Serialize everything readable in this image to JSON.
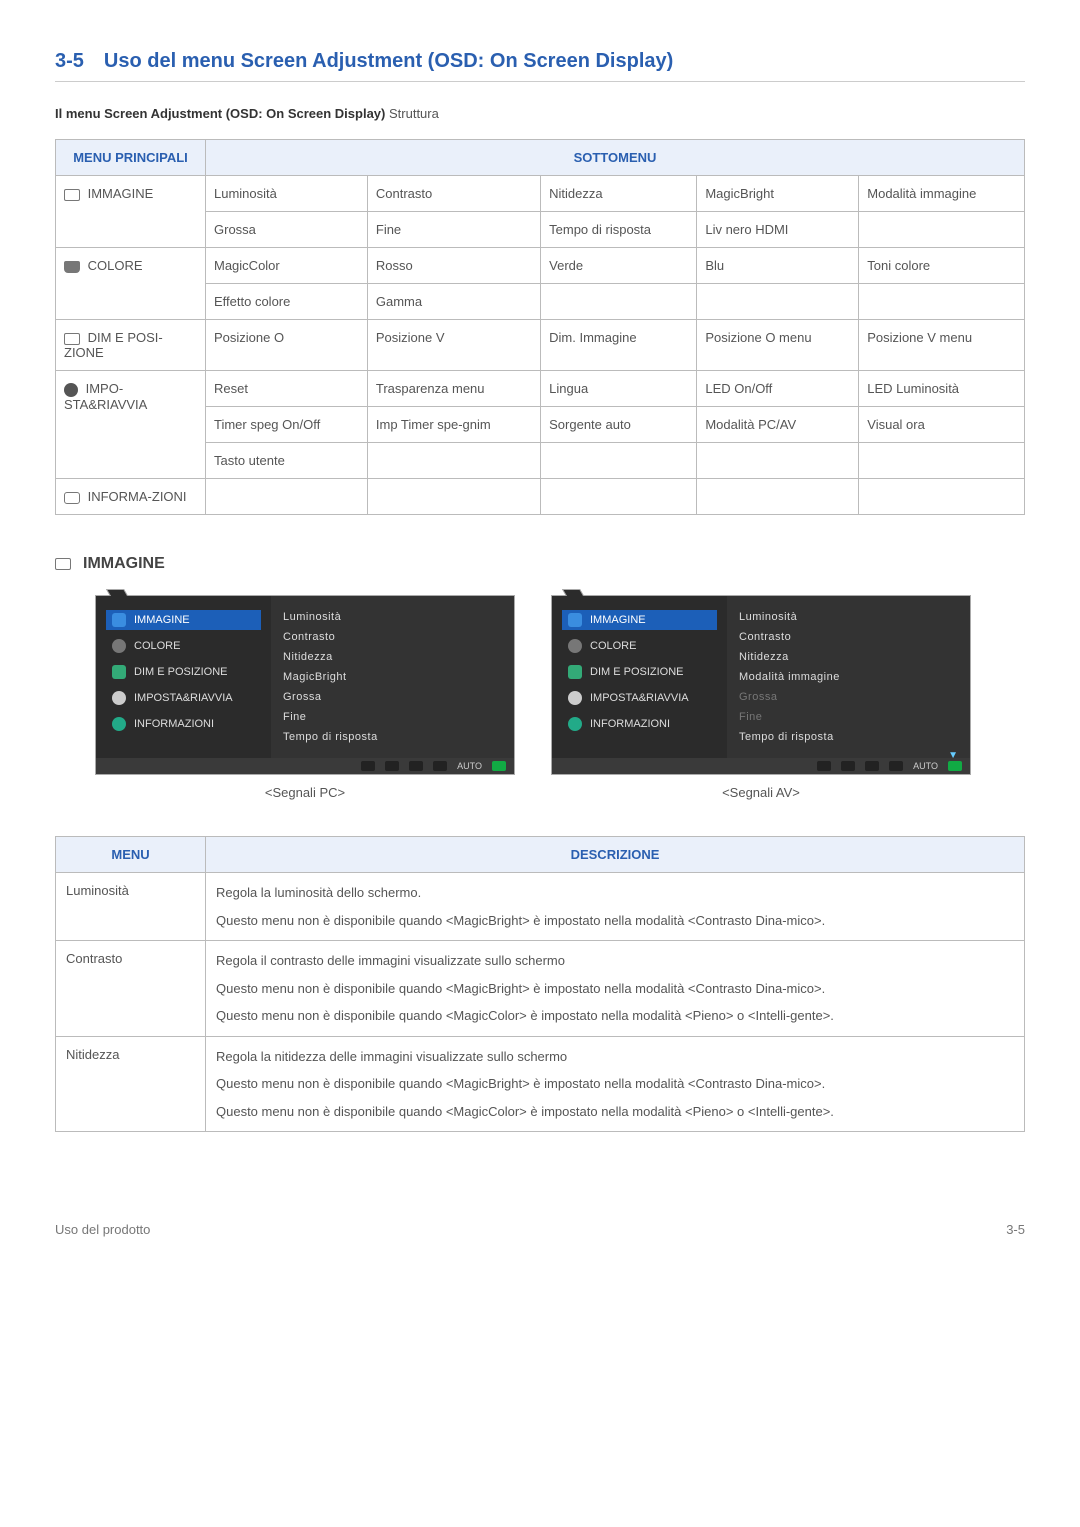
{
  "heading": {
    "num": "3-5",
    "title": "Uso del menu Screen Adjustment (OSD: On Screen Display)"
  },
  "struct_line": {
    "bold": "Il menu Screen Adjustment (OSD: On Screen Display)",
    "rest": " Struttura"
  },
  "grid": {
    "headers": {
      "main": "MENU PRINCIPALI",
      "sub": "SOTTOMENU"
    },
    "rows": [
      {
        "main": "IMMAGINE",
        "icon": "rect",
        "sub": [
          [
            "Luminosità",
            "Contrasto",
            "Nitidezza",
            "MagicBright",
            "Modalità immagine"
          ],
          [
            "Grossa",
            "Fine",
            "Tempo di risposta",
            "Liv nero HDMI",
            ""
          ]
        ]
      },
      {
        "main": "COLORE",
        "icon": "paint",
        "sub": [
          [
            "MagicColor",
            "Rosso",
            "Verde",
            "Blu",
            "Toni colore"
          ],
          [
            "Effetto colore",
            "Gamma",
            "",
            "",
            ""
          ]
        ]
      },
      {
        "main": "DIM E POSI-ZIONE",
        "icon": "grid",
        "sub": [
          [
            "Posizione O",
            "Posizione V",
            "Dim. Immagine",
            "Posizione O menu",
            "Posizione V menu"
          ]
        ]
      },
      {
        "main": "IMPO-STA&RIAVVIA",
        "icon": "gear",
        "sub": [
          [
            "Reset",
            "Trasparenza menu",
            "Lingua",
            "LED On/Off",
            "LED Luminosità"
          ],
          [
            "Timer speg On/Off",
            "Imp Timer spe-gnim",
            "Sorgente auto",
            "Modalità PC/AV",
            "Visual ora"
          ],
          [
            "Tasto utente",
            "",
            "",
            "",
            ""
          ]
        ]
      },
      {
        "main": "INFORMA-ZIONI",
        "icon": "info",
        "sub": [
          [
            "",
            "",
            "",
            "",
            ""
          ]
        ]
      }
    ]
  },
  "section_immagine": "IMMAGINE",
  "screenshots": {
    "side_items": [
      "IMMAGINE",
      "COLORE",
      "DIM E POSIZIONE",
      "IMPOSTA&RIAVVIA",
      "INFORMAZIONI"
    ],
    "pc": {
      "caption": "<Segnali PC>",
      "sub": [
        "Luminosità",
        "Contrasto",
        "Nitidezza",
        "MagicBright",
        "Grossa",
        "Fine",
        "Tempo di risposta"
      ]
    },
    "av": {
      "caption": "<Segnali AV>",
      "sub": [
        "Luminosità",
        "Contrasto",
        "Nitidezza",
        "Modalità immagine",
        "Grossa",
        "Fine",
        "Tempo di risposta"
      ],
      "dim_idx": [
        4,
        5
      ]
    },
    "footer_auto": "AUTO"
  },
  "desc": {
    "headers": {
      "menu": "MENU",
      "desc": "DESCRIZIONE"
    },
    "rows": [
      {
        "menu": "Luminosità",
        "paras": [
          "Regola la luminosità dello schermo.",
          "Questo menu non è disponibile quando <MagicBright> è impostato nella modalità <Contrasto Dina-mico>."
        ]
      },
      {
        "menu": "Contrasto",
        "paras": [
          "Regola il contrasto delle immagini visualizzate sullo schermo",
          "Questo menu non è disponibile quando <MagicBright> è impostato nella modalità <Contrasto Dina-mico>.",
          "Questo menu non è disponibile quando <MagicColor> è impostato nella modalità <Pieno> o <Intelli-gente>."
        ]
      },
      {
        "menu": "Nitidezza",
        "paras": [
          "Regola la nitidezza delle immagini visualizzate sullo schermo",
          "Questo menu non è disponibile quando <MagicBright> è impostato nella modalità <Contrasto Dina-mico>.",
          "Questo menu non è disponibile quando <MagicColor> è impostato nella modalità <Pieno> o <Intelli-gente>."
        ]
      }
    ]
  },
  "footer": {
    "left": "Uso del prodotto",
    "right": "3-5"
  }
}
